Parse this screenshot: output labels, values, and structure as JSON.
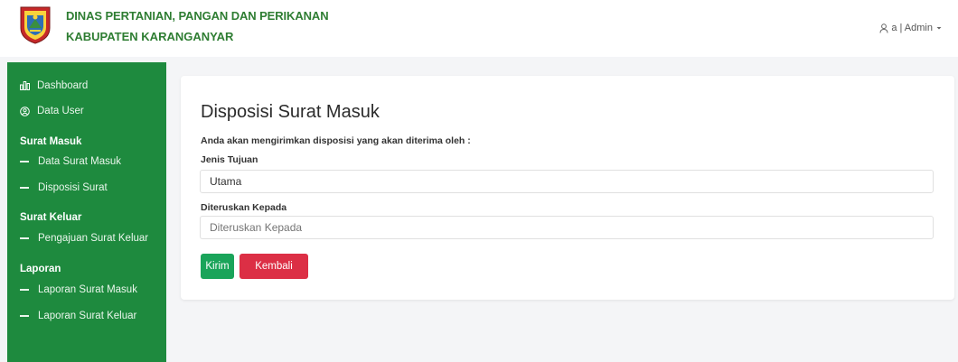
{
  "header": {
    "title_line1": "DINAS PERTANIAN, PANGAN DAN PERIKANAN",
    "title_line2": "KABUPATEN KARANGANYAR",
    "user_label": "a | Admin"
  },
  "sidebar": {
    "items": [
      {
        "label": "Dashboard",
        "icon": "bar-chart-icon"
      },
      {
        "label": "Data User",
        "icon": "user-circle-icon"
      }
    ],
    "sections": [
      {
        "heading": "Surat Masuk",
        "items": [
          "Data Surat Masuk",
          "Disposisi Surat"
        ]
      },
      {
        "heading": "Surat Keluar",
        "items": [
          "Pengajuan Surat Keluar"
        ]
      },
      {
        "heading": "Laporan",
        "items": [
          "Laporan Surat Masuk",
          "Laporan Surat Keluar"
        ]
      }
    ]
  },
  "form": {
    "title": "Disposisi Surat Masuk",
    "intro": "Anda akan mengirimkan disposisi yang akan diterima oleh :",
    "jenis_label": "Jenis Tujuan",
    "jenis_value": "Utama",
    "diteruskan_label": "Diteruskan Kepada",
    "diteruskan_placeholder": "Diteruskan Kepada",
    "submit_label": "Kirim",
    "back_label": "Kembali"
  },
  "colors": {
    "sidebar": "#1e8a3e",
    "brand_text": "#2e7d32",
    "submit": "#1aa45a",
    "back": "#dc2f45"
  }
}
